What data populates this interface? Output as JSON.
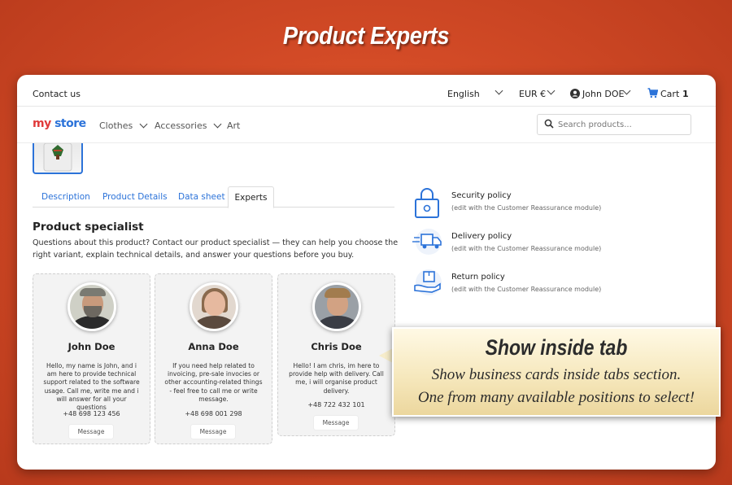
{
  "banner": {
    "title": "Product Experts"
  },
  "topbar": {
    "contact": "Contact us",
    "language": "English",
    "currency": "EUR €",
    "user": "John DOE",
    "cart_label": "Cart",
    "cart_count": "1"
  },
  "navbar": {
    "logo_word1": "my",
    "logo_word2": "store",
    "items": [
      "Clothes",
      "Accessories",
      "Art"
    ],
    "search_placeholder": "Search products..."
  },
  "tabs": [
    "Description",
    "Product Details",
    "Data sheet",
    "Experts"
  ],
  "specialist": {
    "title": "Product specialist",
    "description": "Questions about this product? Contact our product specialist — they can help you choose the right variant, explain technical details, and answer your questions before you buy."
  },
  "experts": [
    {
      "name": "John Doe",
      "bio": "Hello, my name is John, and i am here to provide technical support related to the software usage. Call me, write me and i will answer for all your questions",
      "phone": "+48 698 123 456",
      "button": "Message"
    },
    {
      "name": "Anna Doe",
      "bio": "If you need help related to invoicing, pre-sale invocies or other accounting-related things - feel free to call me or write message.",
      "phone": "+48 698 001 298",
      "button": "Message"
    },
    {
      "name": "Chris Doe",
      "bio": "Hello! I am chris, im here to provide help with delivery. Call me, i will organise product delivery.",
      "phone": "+48 722 432 101",
      "button": "Message"
    }
  ],
  "reassurance": [
    {
      "title": "Security policy",
      "subtitle": "(edit with the Customer Reassurance module)",
      "icon": "lock-icon"
    },
    {
      "title": "Delivery policy",
      "subtitle": "(edit with the Customer Reassurance module)",
      "icon": "delivery-truck-icon"
    },
    {
      "title": "Return policy",
      "subtitle": "(edit with the Customer Reassurance module)",
      "icon": "return-box-icon"
    }
  ],
  "callout": {
    "heading": "Show inside tab",
    "line1": "Show business cards inside tabs section.",
    "line2": "One from many available positions to select!"
  },
  "colors": {
    "accent": "#2c73d9",
    "background": "#d24a26"
  }
}
